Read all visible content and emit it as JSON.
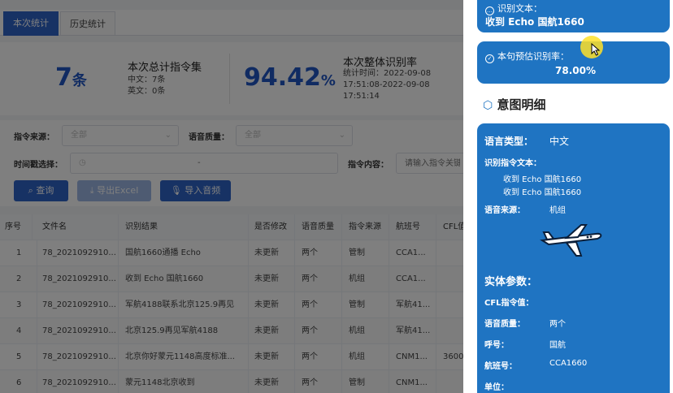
{
  "tabs": [
    "本次统计",
    "历史统计"
  ],
  "stats": {
    "count_value": "7",
    "count_unit": "条",
    "total_title": "本次总计指令集",
    "cn_line": "中文：7条",
    "en_line": "英文：0条",
    "rate_value": "94.42",
    "rate_unit": "%",
    "rate_title": "本次整体识别率",
    "time_line1": "统计时间：2022-09-08",
    "time_line2": "17:51:08-2022-09-08",
    "time_line3": "17:51:14"
  },
  "filters": {
    "source_label": "指令来源：",
    "source_value": "全部",
    "quality_label": "语音质量：",
    "quality_value": "全部",
    "time_label": "时间戳选择：",
    "time_sep": "-",
    "content_label": "指令内容：",
    "content_placeholder": "请输入指令关键",
    "query_button": "查询",
    "export_button": "导出Excel",
    "import_button": "导入音频"
  },
  "table": {
    "columns": [
      "序号",
      "文件名",
      "识别结果",
      "是否修改",
      "语音质量",
      "指令来源",
      "航班号",
      "CFL值"
    ],
    "rows": [
      [
        "1",
        "78_2021092910...",
        "国航1660通播 Echo",
        "未更新",
        "两个",
        "管制",
        "CCA1...",
        ""
      ],
      [
        "2",
        "78_2021092910...",
        "收到 Echo 国航1660",
        "未更新",
        "两个",
        "机组",
        "CCA1...",
        ""
      ],
      [
        "3",
        "78_2021092910...",
        "军航4188联系北京125.9再见",
        "未更新",
        "两个",
        "管制",
        "军航41...",
        ""
      ],
      [
        "4",
        "78_2021092910...",
        "北京125.9再见军航4188",
        "未更新",
        "两个",
        "机组",
        "军航41...",
        ""
      ],
      [
        "5",
        "78_2021092910...",
        "北京你好蒙元1148高度标准...",
        "未更新",
        "两个",
        "机组",
        "CNM1...",
        "3600"
      ],
      [
        "6",
        "78_2021092910...",
        "蒙元1148北京收到",
        "未更新",
        "两个",
        "管制",
        "CNM1...",
        ""
      ]
    ]
  },
  "drawer": {
    "recognized_text_label": "识别文本：",
    "recognized_text_value": "收到 Echo 国航1660",
    "rate_label": "本句预估识别率：",
    "rate_value": "78.00%",
    "intent_title": "意图明细",
    "lang_type_label": "语言类型：",
    "lang_type_value": "中文",
    "recognized_cmd_label": "识别指令文本：",
    "recognized_cmd_lines": [
      "收到 Echo 国航1660",
      "收到 Echo 国航1660"
    ],
    "voice_source_label": "语音来源：",
    "voice_source_value": "机组",
    "entity_label": "实体参数：",
    "cfl_label": "CFL指令值：",
    "quality_label": "语音质量：",
    "quality_value": "两个",
    "callsign_label": "呼号：",
    "callsign_value": "国航",
    "flight_label": "航班号：",
    "flight_value": "CCA1660",
    "unit_label": "单位："
  },
  "colors": {
    "accent": "#2f64c8",
    "card": "#1f74c2",
    "stat_number": "#2156c4"
  },
  "icons": {
    "chat": "chat-icon",
    "check": "check-circle-icon",
    "cube": "cube-icon",
    "airplane": "airplane-icon",
    "search": "search-icon",
    "download": "download-icon",
    "mic": "mic-icon",
    "clock": "clock-icon"
  }
}
